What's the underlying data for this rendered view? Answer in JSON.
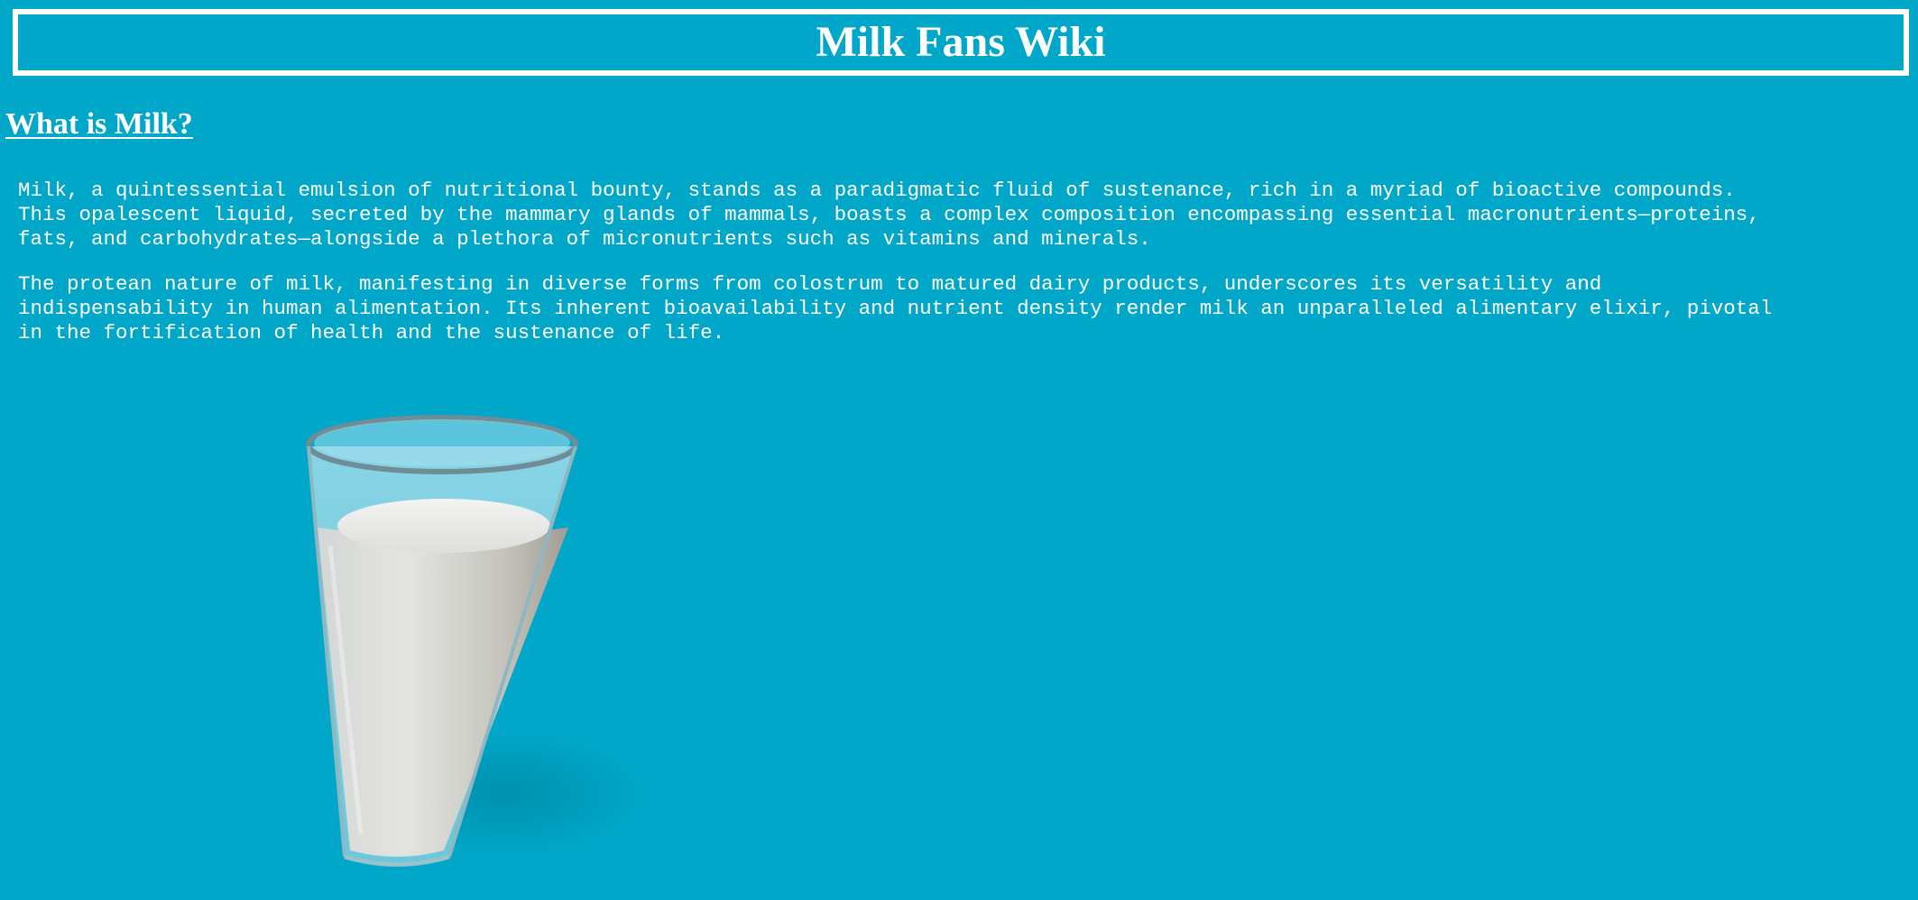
{
  "header": {
    "title": "Milk Fans Wiki"
  },
  "section": {
    "heading": "What is Milk?"
  },
  "article": {
    "paragraphs": [
      "Milk, a quintessential emulsion of nutritional bounty, stands as a paradigmatic fluid of sustenance, rich in a myriad of bioactive compounds.\nThis opalescent liquid, secreted by the mammary glands of mammals, boasts a complex composition encompassing essential macronutrients—proteins,\nfats, and carbohydrates—alongside a plethora of micronutrients such as vitamins and minerals.",
      "The protean nature of milk, manifesting in diverse forms from colostrum to matured dairy products, underscores its versatility and\nindispensability in human alimentation. Its inherent bioavailability and nutrient density render milk an unparalleled alimentary elixir, pivotal\nin the fortification of health and the sustenance of life."
    ]
  },
  "colors": {
    "background": "#00a7c9",
    "text": "#ffffff",
    "milk": "#dcdcd8"
  },
  "image": {
    "subject": "glass-of-milk"
  }
}
